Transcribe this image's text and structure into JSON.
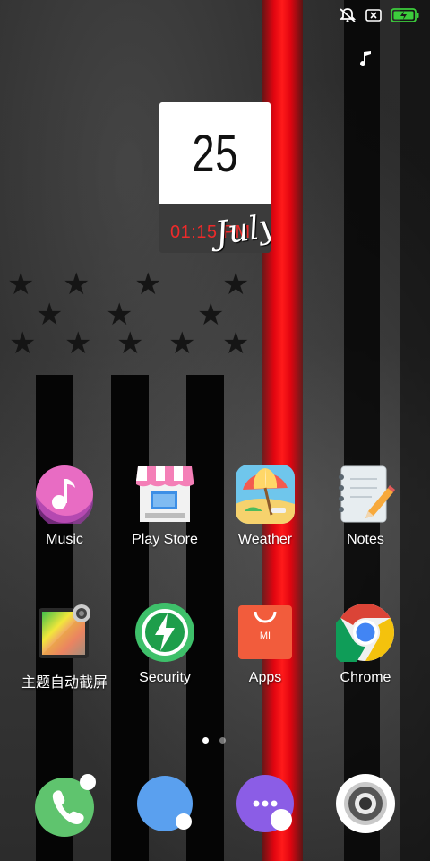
{
  "status_bar": {
    "icons": [
      "notifications-off-icon",
      "sim-off-icon",
      "battery-charging-icon"
    ]
  },
  "media": {
    "icon": "music-note-icon"
  },
  "clock_widget": {
    "day": "25",
    "time": "01:15 PM",
    "month": "July"
  },
  "apps": [
    {
      "label": "Music",
      "icon": "music-icon"
    },
    {
      "label": "Play Store",
      "icon": "play-store-icon"
    },
    {
      "label": "Weather",
      "icon": "weather-icon"
    },
    {
      "label": "Notes",
      "icon": "notes-icon"
    },
    {
      "label": "主题自动截屏",
      "icon": "screenshot-theme-icon"
    },
    {
      "label": "Security",
      "icon": "security-icon"
    },
    {
      "label": "Apps",
      "icon": "apps-store-icon",
      "badge": "MI"
    },
    {
      "label": "Chrome",
      "icon": "chrome-icon"
    }
  ],
  "page_indicator": {
    "pages": 2,
    "current": 1
  },
  "dock": [
    {
      "icon": "phone-icon"
    },
    {
      "icon": "messages-icon"
    },
    {
      "icon": "chat-icon"
    },
    {
      "icon": "camera-icon"
    }
  ],
  "colors": {
    "accent_red": "#e10510",
    "clock_time": "#ee2a2a",
    "battery_green": "#3ccd3c"
  }
}
